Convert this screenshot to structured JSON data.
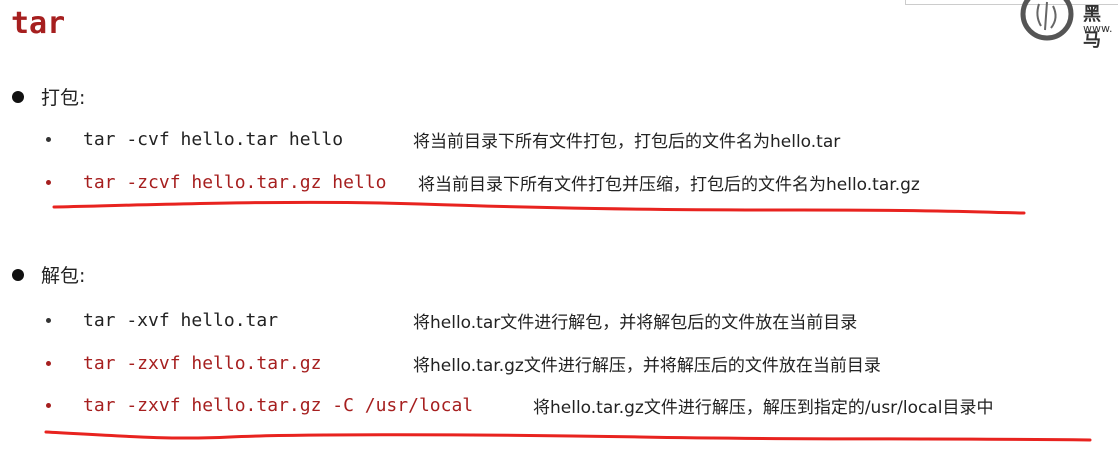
{
  "title": "tar",
  "logo": {
    "text": "黑马",
    "url": "www."
  },
  "sections": [
    {
      "heading": "打包:",
      "items": [
        {
          "command": "tar -cvf hello.tar hello",
          "description": "将当前目录下所有文件打包，打包后的文件名为hello.tar",
          "highlighted": false
        },
        {
          "command": "tar -zcvf hello.tar.gz hello",
          "description": "将当前目录下所有文件打包并压缩，打包后的文件名为hello.tar.gz",
          "highlighted": true
        }
      ]
    },
    {
      "heading": "解包:",
      "items": [
        {
          "command": "tar -xvf hello.tar",
          "description": "将hello.tar文件进行解包，并将解包后的文件放在当前目录",
          "highlighted": false
        },
        {
          "command": "tar -zxvf hello.tar.gz",
          "description": "将hello.tar.gz文件进行解压，并将解压后的文件放在当前目录",
          "highlighted": true
        },
        {
          "command": "tar -zxvf hello.tar.gz -C /usr/local",
          "description": "将hello.tar.gz文件进行解压，解压到指定的/usr/local目录中",
          "highlighted": true
        }
      ]
    }
  ],
  "colors": {
    "accent": "#a61f1f",
    "annotation": "#e8231f",
    "text": "#222222"
  }
}
